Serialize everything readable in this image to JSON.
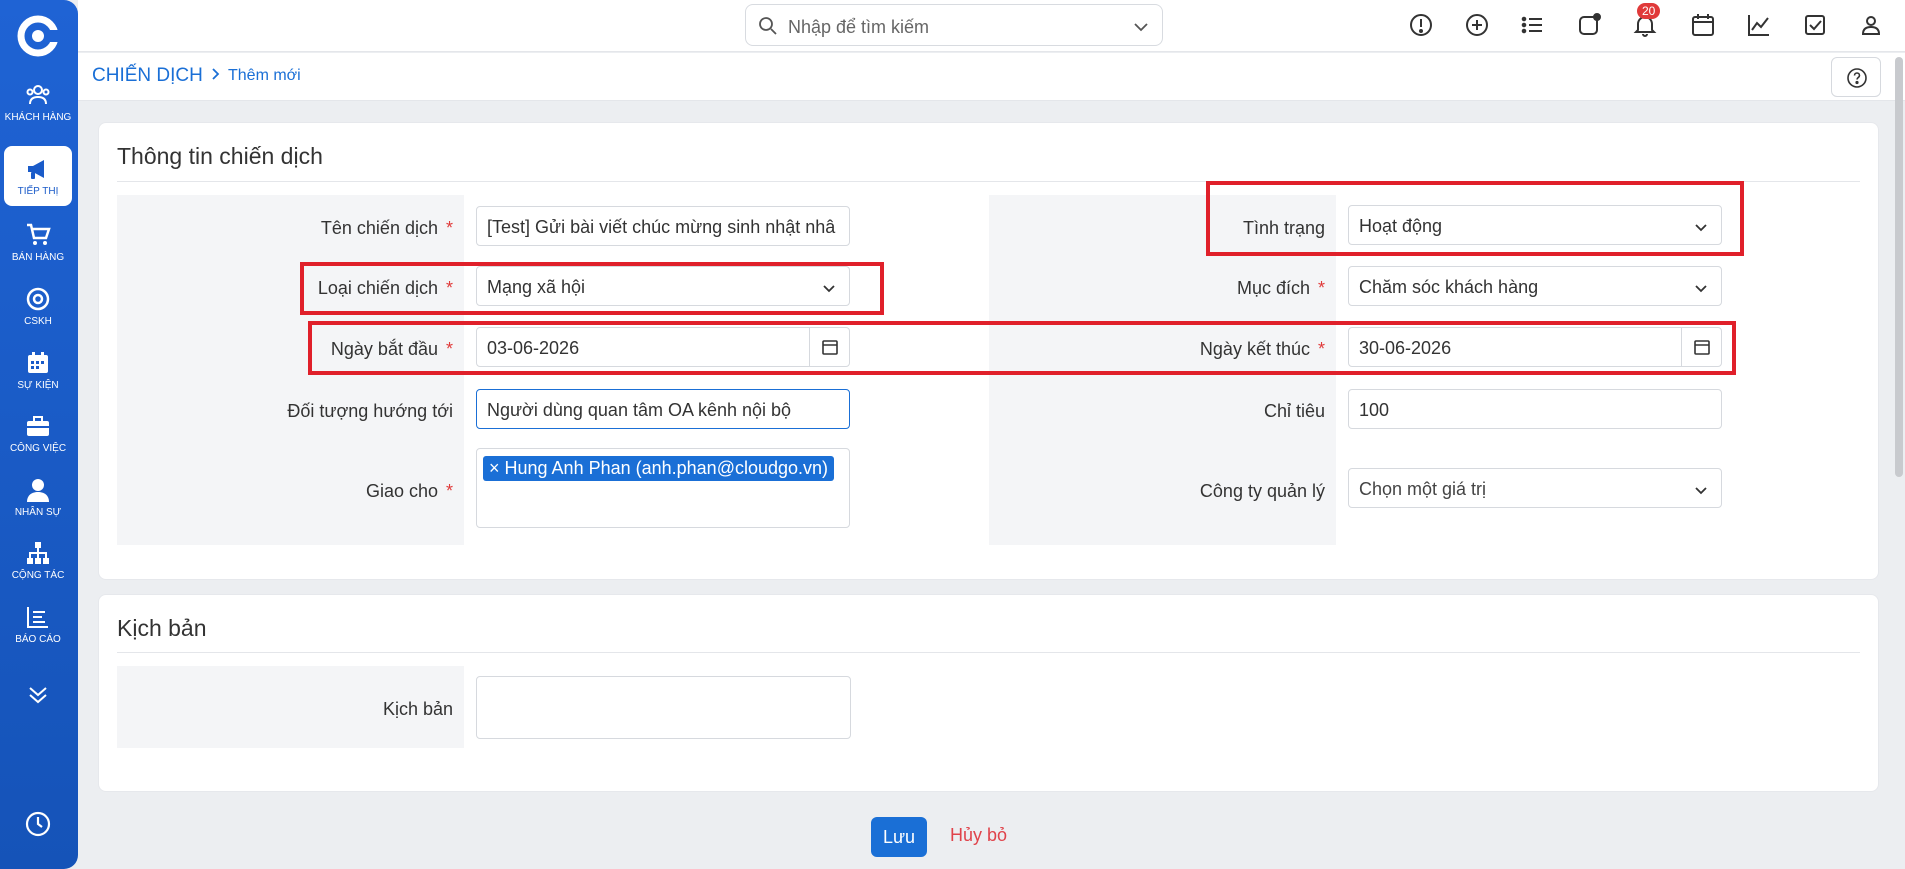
{
  "sidebar": {
    "items": [
      {
        "label": "KHÁCH HÀNG",
        "icon": "users-icon"
      },
      {
        "label": "TIẾP THỊ",
        "icon": "megaphone-icon",
        "active": true
      },
      {
        "label": "BÁN HÀNG",
        "icon": "cart-icon"
      },
      {
        "label": "CSKH",
        "icon": "lifebuoy-icon"
      },
      {
        "label": "SỰ KIỆN",
        "icon": "calendar-grid-icon"
      },
      {
        "label": "CÔNG VIỆC",
        "icon": "briefcase-icon"
      },
      {
        "label": "NHÂN SỰ",
        "icon": "person-icon"
      },
      {
        "label": "CỘNG TÁC",
        "icon": "org-chart-icon"
      },
      {
        "label": "BÁO CÁO",
        "icon": "report-icon"
      }
    ]
  },
  "topbar": {
    "search_placeholder": "Nhập để tìm kiếm",
    "notification_count": "20"
  },
  "breadcrumb": {
    "main": "CHIẾN DỊCH",
    "separator": ">",
    "sub": "Thêm mới"
  },
  "section1": {
    "title": "Thông tin chiến dịch",
    "fields": {
      "campaign_name": {
        "label": "Tên chiến dịch",
        "value": "[Test] Gửi bài viết chúc mừng sinh nhật nhâ"
      },
      "campaign_type": {
        "label": "Loại chiến dịch",
        "value": "Mạng xã hội"
      },
      "start_date": {
        "label": "Ngày bắt đầu",
        "value": "03-06-2026"
      },
      "target": {
        "label": "Đối tượng hướng tới",
        "value": "Người dùng quan tâm OA kênh nội bộ"
      },
      "assigned": {
        "label": "Giao cho",
        "tag": "× Hung Anh Phan (anh.phan@cloudgo.vn)"
      },
      "status": {
        "label": "Tình trạng",
        "value": "Hoạt động"
      },
      "purpose": {
        "label": "Mục đích",
        "value": "Chăm sóc khách hàng"
      },
      "end_date": {
        "label": "Ngày kết thúc",
        "value": "30-06-2026"
      },
      "quota": {
        "label": "Chỉ tiêu",
        "value": "100"
      },
      "company": {
        "label": "Công ty quản lý",
        "value": "Chọn một giá trị"
      }
    },
    "required_mark": "*"
  },
  "section2": {
    "title": "Kịch bản",
    "script_label": "Kịch bản"
  },
  "footer": {
    "save": "Lưu",
    "cancel": "Hủy bỏ"
  },
  "colors": {
    "sidebar": "#1a5bc9",
    "accent": "#1a6fd6",
    "highlight": "#e0202a",
    "required": "#e03a3a"
  }
}
